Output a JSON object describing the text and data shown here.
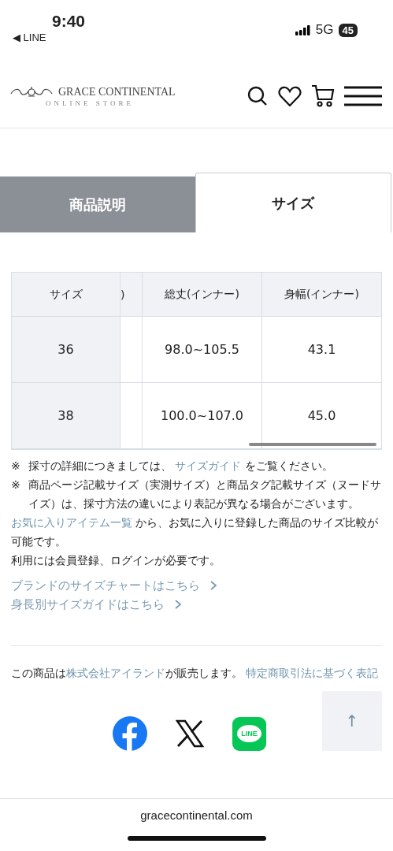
{
  "status_bar": {
    "time": "9:40",
    "back_label": "◀ LINE",
    "network": "5G",
    "battery": "45"
  },
  "header": {
    "brand": "GRACE CONTINENTAL",
    "sub": "ONLINE STORE"
  },
  "tabs": [
    {
      "label": "商品説明",
      "selected": false
    },
    {
      "label": "サイズ",
      "selected": true
    }
  ],
  "size_table": {
    "columns": [
      "サイズ",
      ")",
      "総丈(インナー)",
      "身幅(インナー)"
    ],
    "rows": [
      [
        "36",
        "",
        "98.0~105.5",
        "43.1"
      ],
      [
        "38",
        "",
        "100.0~107.0",
        "45.0"
      ]
    ]
  },
  "notes": [
    [
      {
        "text": "※ "
      },
      {
        "text": "採寸の詳細につきましては、 "
      },
      {
        "text": "サイズガイド",
        "link": true
      },
      {
        "text": " をご覧ください。"
      }
    ],
    [
      {
        "text": "※ "
      },
      {
        "text": "商品ページ記載サイズ（実測サイズ）と商品タグ記載サイズ（ヌードサイズ）は、採寸方法の違いにより表記が異なる場合がございます。"
      }
    ]
  ],
  "favorites_note": [
    {
      "text": "お気に入りアイテム一覧",
      "link": true
    },
    {
      "text": " から、お気に入りに登録した商品のサイズ比較が可能です。"
    }
  ],
  "login_note": "利用には会員登録、ログインが必要です。",
  "guide_links": [
    "ブランドのサイズチャートはこちら",
    "身長別サイズガイドはこちら"
  ],
  "seller": [
    {
      "text": "この商品は"
    },
    {
      "text": "株式会社アイランド",
      "link": true
    },
    {
      "text": "が販売します。 "
    },
    {
      "text": "特定商取引法に基づく表記",
      "link": true
    }
  ],
  "share": [
    {
      "kind": "facebook"
    },
    {
      "kind": "x"
    },
    {
      "kind": "line",
      "label": "LINE"
    }
  ],
  "back_to_top": "↑",
  "browser": {
    "url": "gracecontinental.com"
  }
}
